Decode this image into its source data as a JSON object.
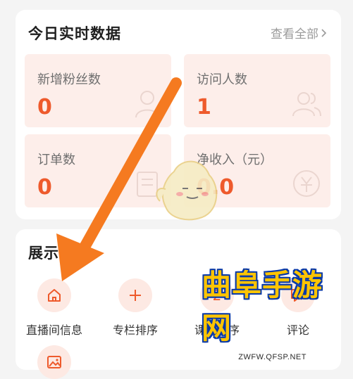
{
  "stats": {
    "title": "今日实时数据",
    "view_all": "查看全部",
    "items": [
      {
        "label": "新增粉丝数",
        "value": "0",
        "icon": "user-icon"
      },
      {
        "label": "访问人数",
        "value": "1",
        "icon": "users-icon"
      },
      {
        "label": "订单数",
        "value": "0",
        "icon": "order-icon"
      },
      {
        "label": "净收入（元）",
        "value": "0.0",
        "icon": "money-icon"
      }
    ]
  },
  "display": {
    "title": "展示管理",
    "tools": [
      {
        "label": "直播间信息",
        "icon": "home-icon"
      },
      {
        "label": "专栏排序",
        "icon": "plus-icon"
      },
      {
        "label": "课程排序",
        "icon": "2"
      },
      {
        "label": "评论",
        "icon": "comment-icon"
      }
    ]
  },
  "watermark": {
    "text": "曲阜手游网",
    "url": "ZWFW.QFSP.NET"
  },
  "colors": {
    "accent": "#ee5a2c",
    "tile_bg": "#fdeeea",
    "arrow": "#f57a20"
  }
}
